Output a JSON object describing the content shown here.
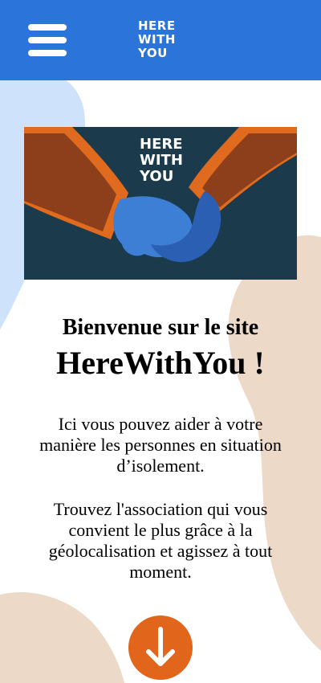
{
  "colors": {
    "header_bg": "#2b74d9",
    "accent_orange": "#e2651c",
    "blob_blue": "#cfe2fb",
    "blob_beige": "#edd9c8",
    "hero_bg": "#1b3a4b"
  },
  "header": {
    "menu_icon": "hamburger-menu-icon",
    "logo_lines": [
      "HERE",
      "WITH",
      "YOU"
    ]
  },
  "hero": {
    "logo_lines": [
      "HERE",
      "WITH",
      "YOU"
    ],
    "illustration": "holding-hands-illustration"
  },
  "welcome": {
    "line1": "Bienvenue sur le site",
    "line2": "HereWithYou !"
  },
  "intro": {
    "paragraph1": "Ici vous pouvez aider à votre manière les personnes en situation d’isolement.",
    "paragraph2": "Trouvez l'association qui vous convient le plus grâce à la géolocalisation et agissez à tout moment."
  },
  "scroll_button": {
    "icon": "arrow-down-icon"
  }
}
